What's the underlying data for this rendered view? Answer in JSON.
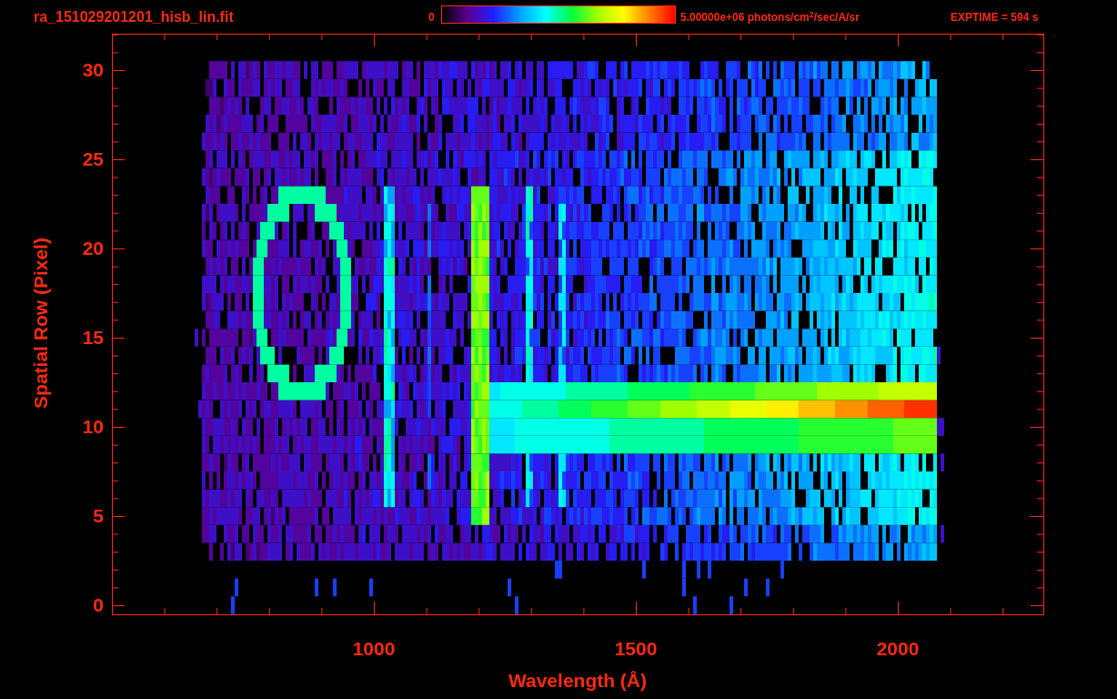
{
  "title": "ra_151029201201_hisb_lin.fit",
  "colorbar": {
    "min_label": "0",
    "max_label": "5.00000e+06 photons/cm$^{2}$/sec/A/sr"
  },
  "exposure": "EXPTIME = 594 s",
  "plot": {
    "xlabel": "Wavelength (Å)",
    "ylabel": "Spatial Row (Pixel)",
    "xtick_labels": [
      "1000",
      "1500",
      "2000"
    ],
    "ytick_labels": [
      "30",
      "25",
      "20",
      "15",
      "10",
      "5",
      "0"
    ]
  }
}
